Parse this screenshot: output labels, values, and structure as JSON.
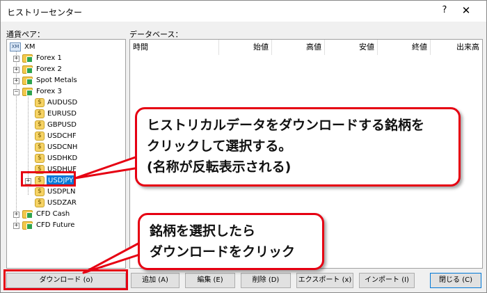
{
  "window": {
    "title": "ヒストリーセンター",
    "help_label": "?",
    "close_label": "✕"
  },
  "labels": {
    "currency_pairs": "通貨ペア：",
    "database": "データベース："
  },
  "tree": {
    "root": "XM",
    "groups": [
      "Forex 1",
      "Forex 2",
      "Spot Metals",
      "Forex 3"
    ],
    "forex3_symbols": [
      "AUDUSD",
      "EURUSD",
      "GBPUSD",
      "USDCHF",
      "USDCNH",
      "USDHKD",
      "USDHUF",
      "USDJPY",
      "USDPLN",
      "USDZAR"
    ],
    "bottom_groups": [
      "CFD Cash",
      "CFD Future"
    ],
    "selected": "USDJPY"
  },
  "table": {
    "columns": [
      "時間",
      "始値",
      "高値",
      "安値",
      "終値",
      "出来高"
    ]
  },
  "buttons": {
    "download": "ダウンロード (o)",
    "add": "追加 (A)",
    "edit": "編集 (E)",
    "delete": "削除 (D)",
    "export": "エクスポート (x)",
    "import": "インポート (I)",
    "close": "閉じる (C)"
  },
  "callouts": {
    "select_lines": [
      "ヒストリカルデータをダウンロードする銘柄を",
      "クリックして選択する。",
      "(名称が反転表示される)"
    ],
    "download_lines": [
      "銘柄を選択したら",
      "ダウンロードをクリック"
    ]
  },
  "colors": {
    "highlight": "#e60012",
    "selection": "#0078d7"
  }
}
